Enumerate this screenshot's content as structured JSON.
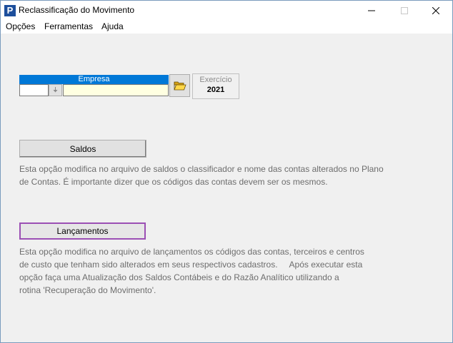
{
  "window": {
    "title": "Reclassificação do Movimento",
    "icon_letter": "P",
    "controls": {
      "minimize_icon": "minimize-icon",
      "maximize_icon": "maximize-icon",
      "close_icon": "close-icon"
    }
  },
  "menu": {
    "items": [
      {
        "label": "Opções"
      },
      {
        "label": "Ferramentas"
      },
      {
        "label": "Ajuda"
      }
    ]
  },
  "empresa": {
    "label": "Empresa",
    "code_value": "",
    "name_value": "",
    "dropdown_icon": "dropdown-arrow-icon",
    "browse_icon": "open-folder-icon"
  },
  "exercicio": {
    "label": "Exercício",
    "value": "2021"
  },
  "saldos": {
    "button_label": "Saldos",
    "description": "Esta opção modifica no arquivo de saldos o classificador e nome das contas alterados no Plano\nde Contas. É importante dizer que os códigos das contas devem ser os mesmos."
  },
  "lancamentos": {
    "button_label": "Lançamentos",
    "description": "Esta opção modifica no arquivo de lançamentos os códigos das contas, terceiros e centros\nde custo que tenham sido alterados em seus respectivos cadastros.     Após executar esta\nopção faça uma Atualização dos Saldos Contábeis e do Razão Analítico utilizando a\nrotina 'Recuperação do Movimento'."
  },
  "colors": {
    "accent": "#0078d7",
    "focus_border": "#9b4fb4",
    "input_highlight": "#ffffe1"
  }
}
